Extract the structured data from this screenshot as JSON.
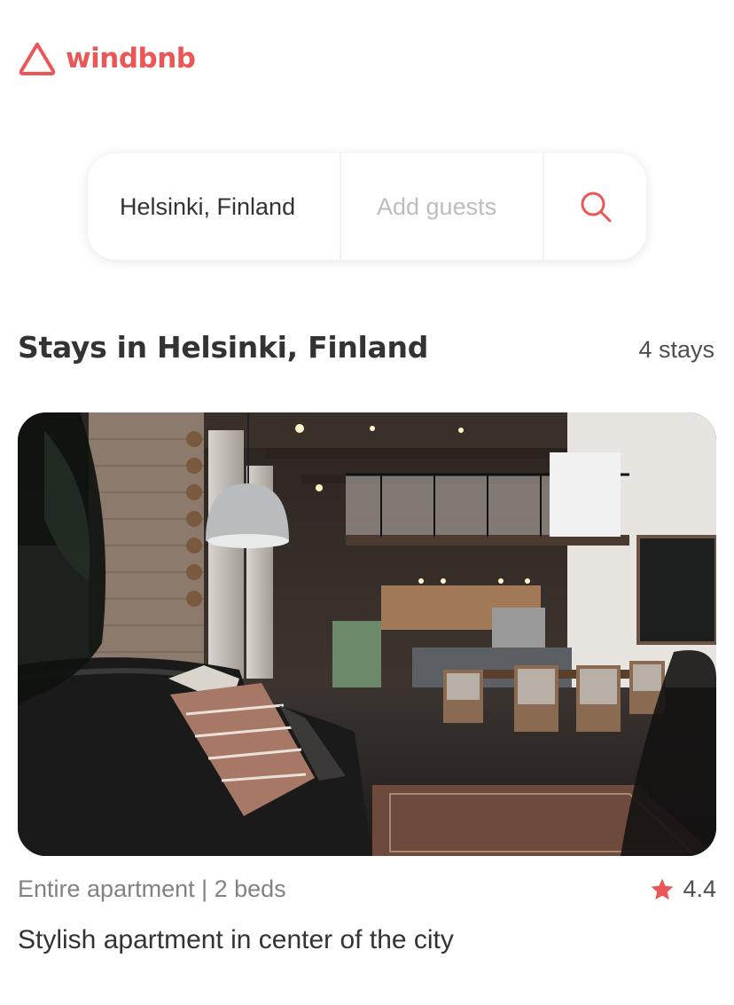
{
  "brand": {
    "name": "windbnb",
    "color": "#EB5757",
    "icon": "logo-triangle-icon"
  },
  "search": {
    "location_value": "Helsinki, Finland",
    "guests_placeholder": "Add guests",
    "button_icon": "search-icon"
  },
  "results": {
    "heading": "Stays in Helsinki, Finland",
    "count_label": "4 stays"
  },
  "stays": [
    {
      "meta": "Entire apartment | 2 beds",
      "rating": "4.4",
      "rating_icon": "star-icon",
      "title": "Stylish apartment in center of the city",
      "image_description_icon": "loft-apartment-photo"
    }
  ],
  "colors": {
    "accent": "#EB5757",
    "text_primary": "#333333",
    "text_secondary": "#828282",
    "placeholder": "#BDBDBD"
  }
}
